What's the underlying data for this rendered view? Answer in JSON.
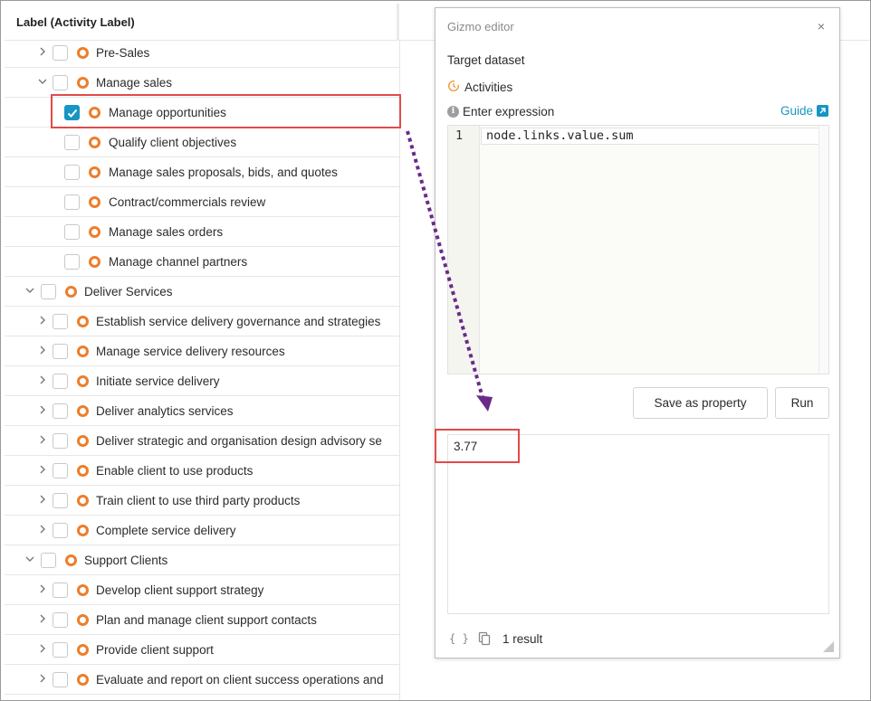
{
  "tree": {
    "header": "Label (Activity Label)",
    "rows": [
      {
        "label": "Pre-Sales"
      },
      {
        "label": "Manage sales"
      },
      {
        "label": "Manage opportunities"
      },
      {
        "label": "Qualify client objectives"
      },
      {
        "label": "Manage sales proposals, bids, and quotes"
      },
      {
        "label": "Contract/commercials review"
      },
      {
        "label": "Manage sales orders"
      },
      {
        "label": "Manage channel partners"
      },
      {
        "label": "Deliver Services"
      },
      {
        "label": "Establish service delivery governance and strategies"
      },
      {
        "label": "Manage service delivery resources"
      },
      {
        "label": "Initiate service delivery"
      },
      {
        "label": "Deliver analytics services"
      },
      {
        "label": "Deliver strategic and organisation design advisory se"
      },
      {
        "label": "Enable client to use products"
      },
      {
        "label": "Train client to use third party products"
      },
      {
        "label": "Complete service delivery"
      },
      {
        "label": "Support Clients"
      },
      {
        "label": "Develop client support strategy"
      },
      {
        "label": "Plan and manage client support contacts"
      },
      {
        "label": "Provide client support"
      },
      {
        "label": "Evaluate and report on client success operations and"
      }
    ]
  },
  "editor": {
    "title": "Gizmo editor",
    "close": "×",
    "target_label": "Target dataset",
    "dataset": "Activities",
    "expression_label": "Enter expression",
    "guide": "Guide",
    "line_number": "1",
    "code": "node.links.value.sum",
    "save_button": "Save as property",
    "run_button": "Run",
    "result_value": "3.77",
    "code_toggle": "{ }",
    "result_count": "1 result"
  },
  "colors": {
    "accent": "#1795c3",
    "node": "#ee7d2a",
    "highlight": "#e24a4a",
    "arrow": "#6a2a8a"
  }
}
